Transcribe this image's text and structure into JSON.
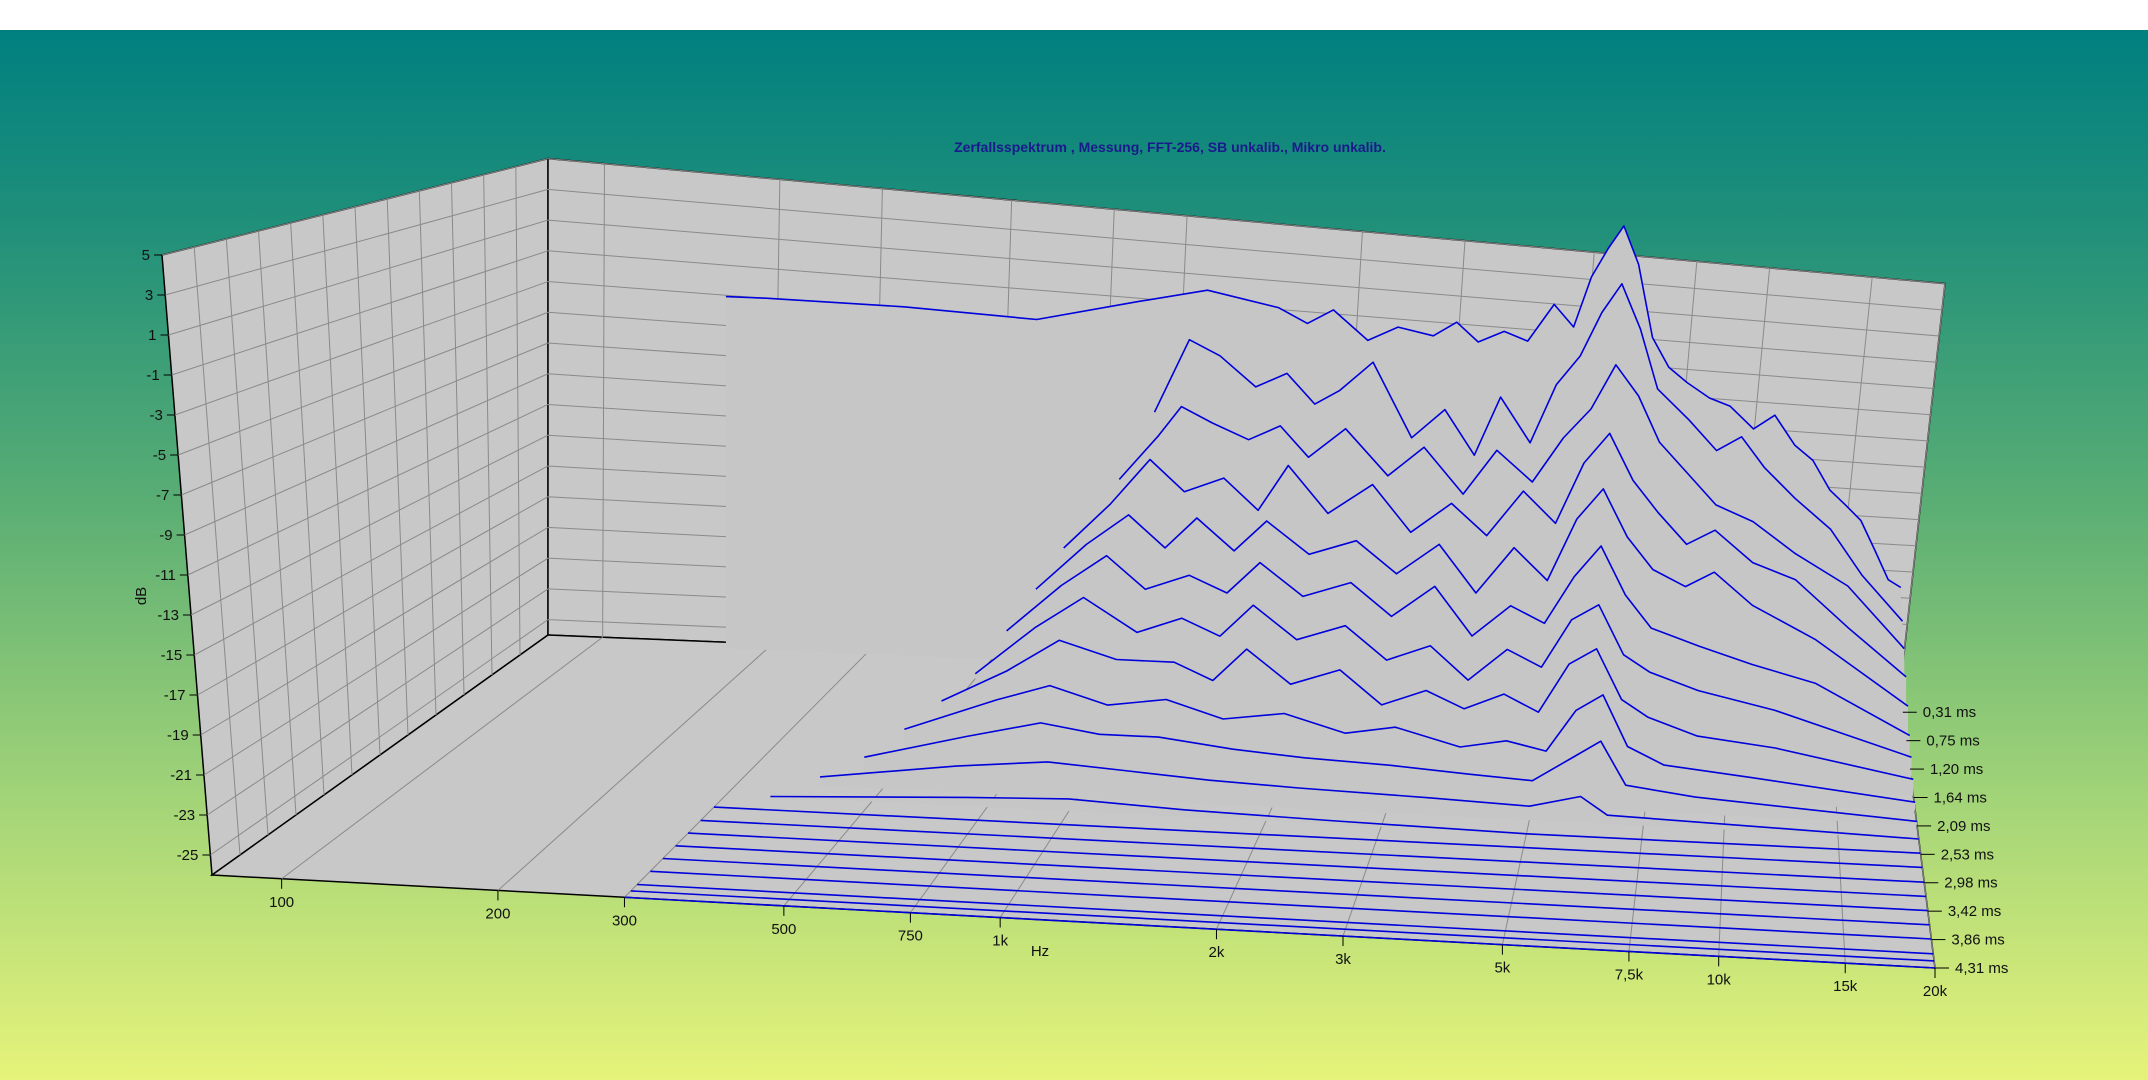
{
  "chart_data": {
    "type": "waterfall",
    "title": "Zerfallsspektrum , Messung, FFT-256, SB unkalib., Mikro unkalib.",
    "xlabel": "Hz",
    "ylabel": "dB",
    "zlabel": "",
    "x_scale": "log",
    "xlim": [
      80,
      20000
    ],
    "ylim": [
      -26,
      5
    ],
    "x_ticks": [
      {
        "value": 100,
        "label": "100"
      },
      {
        "value": 200,
        "label": "200"
      },
      {
        "value": 300,
        "label": "300"
      },
      {
        "value": 500,
        "label": "500"
      },
      {
        "value": 750,
        "label": "750"
      },
      {
        "value": 1000,
        "label": "1k"
      },
      {
        "value": 2000,
        "label": "2k"
      },
      {
        "value": 3000,
        "label": "3k"
      },
      {
        "value": 5000,
        "label": "5k"
      },
      {
        "value": 7500,
        "label": "7,5k"
      },
      {
        "value": 10000,
        "label": "10k"
      },
      {
        "value": 15000,
        "label": "15k"
      },
      {
        "value": 20000,
        "label": "20k"
      }
    ],
    "y_ticks": [
      {
        "value": 5,
        "label": "5"
      },
      {
        "value": 3,
        "label": "3"
      },
      {
        "value": 1,
        "label": "1"
      },
      {
        "value": -1,
        "label": "-1"
      },
      {
        "value": -3,
        "label": "-3"
      },
      {
        "value": -5,
        "label": "-5"
      },
      {
        "value": -7,
        "label": "-7"
      },
      {
        "value": -9,
        "label": "-9"
      },
      {
        "value": -11,
        "label": "-11"
      },
      {
        "value": -13,
        "label": "-13"
      },
      {
        "value": -15,
        "label": "-15"
      },
      {
        "value": -17,
        "label": "-17"
      },
      {
        "value": -19,
        "label": "-19"
      },
      {
        "value": -21,
        "label": "-21"
      },
      {
        "value": -23,
        "label": "-23"
      },
      {
        "value": -25,
        "label": "-25"
      }
    ],
    "z_ticks": [
      "0,31 ms",
      "0,75 ms",
      "1,20 ms",
      "1,64 ms",
      "2,09 ms",
      "2,53 ms",
      "2,98 ms",
      "3,42 ms",
      "3,86 ms",
      "4,31 ms"
    ],
    "slice_count": 22,
    "grid": true,
    "colors": {
      "trace": "#0000dd",
      "surface": "#c6c6c6",
      "wall": "#c8c8c8",
      "grid": "#8a8a8a",
      "title": "#1a1a8c"
    },
    "slices": [
      {
        "t_ms": 0.1,
        "points": [
          [
            170,
            -1.8
          ],
          [
            200,
            -1.8
          ],
          [
            350,
            -2
          ],
          [
            600,
            -2.5
          ],
          [
            900,
            -1
          ],
          [
            1200,
            0
          ],
          [
            1600,
            -1
          ],
          [
            1800,
            -2
          ],
          [
            2000,
            -1
          ],
          [
            2300,
            -3
          ],
          [
            2600,
            -2
          ],
          [
            3000,
            -2.5
          ],
          [
            3300,
            -1.5
          ],
          [
            3600,
            -2.8
          ],
          [
            4000,
            -2
          ],
          [
            4400,
            -2.6
          ],
          [
            4900,
            0
          ],
          [
            5300,
            -1.5
          ],
          [
            5700,
            2
          ],
          [
            6100,
            4
          ],
          [
            6500,
            5.6
          ],
          [
            6900,
            3
          ],
          [
            7300,
            -2
          ],
          [
            7800,
            -4
          ],
          [
            8400,
            -5
          ],
          [
            9200,
            -6
          ],
          [
            10000,
            -6.5
          ],
          [
            11000,
            -8
          ],
          [
            12000,
            -7
          ],
          [
            13000,
            -9
          ],
          [
            14000,
            -10
          ],
          [
            15000,
            -12
          ],
          [
            16000,
            -13
          ],
          [
            17000,
            -14
          ],
          [
            18000,
            -16
          ],
          [
            19000,
            -18
          ],
          [
            20000,
            -18.5
          ]
        ]
      },
      {
        "t_ms": 0.31,
        "points": [
          [
            1000,
            -8
          ],
          [
            1150,
            -3
          ],
          [
            1300,
            -4
          ],
          [
            1500,
            -6
          ],
          [
            1700,
            -5
          ],
          [
            1900,
            -7
          ],
          [
            2100,
            -6
          ],
          [
            2400,
            -4
          ],
          [
            2800,
            -9
          ],
          [
            3200,
            -7
          ],
          [
            3600,
            -10
          ],
          [
            4000,
            -6
          ],
          [
            4500,
            -9
          ],
          [
            5000,
            -5
          ],
          [
            5500,
            -3
          ],
          [
            6000,
            0
          ],
          [
            6500,
            2
          ],
          [
            7000,
            -1
          ],
          [
            7500,
            -5
          ],
          [
            8500,
            -7
          ],
          [
            9500,
            -9
          ],
          [
            10500,
            -8
          ],
          [
            11500,
            -10
          ],
          [
            13000,
            -12
          ],
          [
            15000,
            -14
          ],
          [
            17000,
            -17
          ],
          [
            20000,
            -20
          ]
        ]
      },
      {
        "t_ms": 0.53,
        "points": [
          [
            900,
            -12
          ],
          [
            1050,
            -9
          ],
          [
            1150,
            -7
          ],
          [
            1300,
            -8
          ],
          [
            1500,
            -9
          ],
          [
            1700,
            -8
          ],
          [
            1900,
            -10
          ],
          [
            2200,
            -8
          ],
          [
            2600,
            -11
          ],
          [
            3000,
            -9
          ],
          [
            3500,
            -12
          ],
          [
            4000,
            -9
          ],
          [
            4600,
            -11
          ],
          [
            5200,
            -8
          ],
          [
            5800,
            -6
          ],
          [
            6400,
            -3
          ],
          [
            7000,
            -5
          ],
          [
            7600,
            -8
          ],
          [
            8500,
            -10
          ],
          [
            9500,
            -12
          ],
          [
            11000,
            -13
          ],
          [
            13000,
            -15
          ],
          [
            16000,
            -17
          ],
          [
            20000,
            -21
          ]
        ]
      },
      {
        "t_ms": 0.75,
        "points": [
          [
            750,
            -16
          ],
          [
            900,
            -13
          ],
          [
            1050,
            -10
          ],
          [
            1200,
            -12
          ],
          [
            1400,
            -11
          ],
          [
            1600,
            -13
          ],
          [
            1800,
            -10
          ],
          [
            2100,
            -13
          ],
          [
            2500,
            -11
          ],
          [
            2900,
            -14
          ],
          [
            3400,
            -12
          ],
          [
            3900,
            -14
          ],
          [
            4500,
            -11
          ],
          [
            5100,
            -13
          ],
          [
            5700,
            -9
          ],
          [
            6300,
            -7
          ],
          [
            6900,
            -10
          ],
          [
            7600,
            -12
          ],
          [
            8500,
            -14
          ],
          [
            9500,
            -13
          ],
          [
            11000,
            -15
          ],
          [
            13000,
            -16
          ],
          [
            16000,
            -19
          ],
          [
            20000,
            -22
          ]
        ]
      },
      {
        "t_ms": 0.98,
        "points": [
          [
            700,
            -18
          ],
          [
            850,
            -15
          ],
          [
            1000,
            -13
          ],
          [
            1150,
            -15
          ],
          [
            1300,
            -13
          ],
          [
            1500,
            -15
          ],
          [
            1700,
            -13
          ],
          [
            2000,
            -15
          ],
          [
            2400,
            -14
          ],
          [
            2800,
            -16
          ],
          [
            3300,
            -14
          ],
          [
            3800,
            -17
          ],
          [
            4400,
            -14
          ],
          [
            5000,
            -16
          ],
          [
            5600,
            -12
          ],
          [
            6200,
            -10
          ],
          [
            6800,
            -13
          ],
          [
            7500,
            -15
          ],
          [
            8500,
            -16
          ],
          [
            9500,
            -15
          ],
          [
            11000,
            -17
          ],
          [
            14000,
            -19
          ],
          [
            20000,
            -23
          ]
        ]
      },
      {
        "t_ms": 1.2,
        "points": [
          [
            650,
            -20
          ],
          [
            800,
            -17
          ],
          [
            950,
            -15
          ],
          [
            1100,
            -17
          ],
          [
            1300,
            -16
          ],
          [
            1500,
            -17
          ],
          [
            1700,
            -15
          ],
          [
            2000,
            -17
          ],
          [
            2400,
            -16
          ],
          [
            2800,
            -18
          ],
          [
            3300,
            -16
          ],
          [
            3800,
            -19
          ],
          [
            4400,
            -17
          ],
          [
            5000,
            -18
          ],
          [
            5600,
            -15
          ],
          [
            6200,
            -13
          ],
          [
            6800,
            -16
          ],
          [
            7500,
            -18
          ],
          [
            9000,
            -19
          ],
          [
            11000,
            -20
          ],
          [
            14000,
            -21
          ],
          [
            20000,
            -24
          ]
        ]
      },
      {
        "t_ms": 1.42,
        "points": [
          [
            600,
            -22
          ],
          [
            750,
            -19
          ],
          [
            900,
            -17
          ],
          [
            1100,
            -19
          ],
          [
            1300,
            -18
          ],
          [
            1500,
            -19
          ],
          [
            1700,
            -17
          ],
          [
            2000,
            -19
          ],
          [
            2400,
            -18
          ],
          [
            2800,
            -20
          ],
          [
            3300,
            -19
          ],
          [
            3800,
            -21
          ],
          [
            4400,
            -19
          ],
          [
            5000,
            -20
          ],
          [
            5600,
            -17
          ],
          [
            6200,
            -16
          ],
          [
            6800,
            -19
          ],
          [
            7500,
            -20
          ],
          [
            9000,
            -21
          ],
          [
            12000,
            -22
          ],
          [
            20000,
            -24.5
          ]
        ]
      },
      {
        "t_ms": 1.64,
        "points": [
          [
            550,
            -23
          ],
          [
            700,
            -21
          ],
          [
            850,
            -19
          ],
          [
            1050,
            -20
          ],
          [
            1300,
            -20
          ],
          [
            1500,
            -21
          ],
          [
            1700,
            -19
          ],
          [
            2000,
            -21
          ],
          [
            2400,
            -20
          ],
          [
            2800,
            -22
          ],
          [
            3300,
            -21
          ],
          [
            3800,
            -22
          ],
          [
            4400,
            -21
          ],
          [
            5000,
            -22
          ],
          [
            5600,
            -19
          ],
          [
            6200,
            -18
          ],
          [
            6800,
            -21
          ],
          [
            7500,
            -22
          ],
          [
            9000,
            -23
          ],
          [
            12000,
            -23.5
          ],
          [
            20000,
            -25
          ]
        ]
      },
      {
        "t_ms": 1.87,
        "points": [
          [
            500,
            -24
          ],
          [
            700,
            -22
          ],
          [
            850,
            -21
          ],
          [
            1050,
            -22
          ],
          [
            1300,
            -21.5
          ],
          [
            1600,
            -22.5
          ],
          [
            2000,
            -22
          ],
          [
            2500,
            -23
          ],
          [
            3000,
            -22.5
          ],
          [
            3800,
            -23.5
          ],
          [
            4500,
            -23
          ],
          [
            5200,
            -23.5
          ],
          [
            5800,
            -21
          ],
          [
            6400,
            -20
          ],
          [
            7000,
            -23
          ],
          [
            8000,
            -24
          ],
          [
            11000,
            -24.5
          ],
          [
            20000,
            -25.5
          ]
        ]
      },
      {
        "t_ms": 2.09,
        "points": [
          [
            450,
            -25
          ],
          [
            650,
            -23.5
          ],
          [
            850,
            -22.5
          ],
          [
            1050,
            -23
          ],
          [
            1300,
            -23
          ],
          [
            1700,
            -23.5
          ],
          [
            2200,
            -23.8
          ],
          [
            3000,
            -24
          ],
          [
            4000,
            -24.3
          ],
          [
            5000,
            -24.5
          ],
          [
            5800,
            -23
          ],
          [
            6400,
            -22
          ],
          [
            7000,
            -24.5
          ],
          [
            9000,
            -25
          ],
          [
            20000,
            -25.8
          ]
        ]
      },
      {
        "t_ms": 2.31,
        "points": [
          [
            400,
            -25.5
          ],
          [
            650,
            -24.5
          ],
          [
            900,
            -24
          ],
          [
            1200,
            -24.3
          ],
          [
            1600,
            -24.6
          ],
          [
            2200,
            -24.8
          ],
          [
            3500,
            -25
          ],
          [
            5000,
            -25.2
          ],
          [
            6000,
            -24.5
          ],
          [
            6600,
            -25.5
          ],
          [
            20000,
            -26
          ]
        ]
      },
      {
        "t_ms": 2.53,
        "points": [
          [
            350,
            -26
          ],
          [
            700,
            -25.5
          ],
          [
            1000,
            -25.3
          ],
          [
            1500,
            -25.6
          ],
          [
            2500,
            -25.8
          ],
          [
            5000,
            -26
          ],
          [
            20000,
            -26
          ]
        ]
      },
      {
        "t_ms": 2.75,
        "points": [
          [
            300,
            -26
          ],
          [
            20000,
            -26
          ]
        ]
      },
      {
        "t_ms": 2.98,
        "points": [
          [
            300,
            -26
          ],
          [
            20000,
            -26
          ]
        ]
      },
      {
        "t_ms": 3.2,
        "points": [
          [
            300,
            -26
          ],
          [
            20000,
            -26
          ]
        ]
      },
      {
        "t_ms": 3.42,
        "points": [
          [
            300,
            -26
          ],
          [
            20000,
            -26
          ]
        ]
      },
      {
        "t_ms": 3.64,
        "points": [
          [
            300,
            -26
          ],
          [
            20000,
            -26
          ]
        ]
      },
      {
        "t_ms": 3.86,
        "points": [
          [
            300,
            -26
          ],
          [
            20000,
            -26
          ]
        ]
      },
      {
        "t_ms": 4.09,
        "points": [
          [
            300,
            -26
          ],
          [
            20000,
            -26
          ]
        ]
      },
      {
        "t_ms": 4.2,
        "points": [
          [
            300,
            -26
          ],
          [
            20000,
            -26
          ]
        ]
      },
      {
        "t_ms": 4.31,
        "points": [
          [
            300,
            -26
          ],
          [
            20000,
            -26
          ]
        ]
      }
    ]
  }
}
